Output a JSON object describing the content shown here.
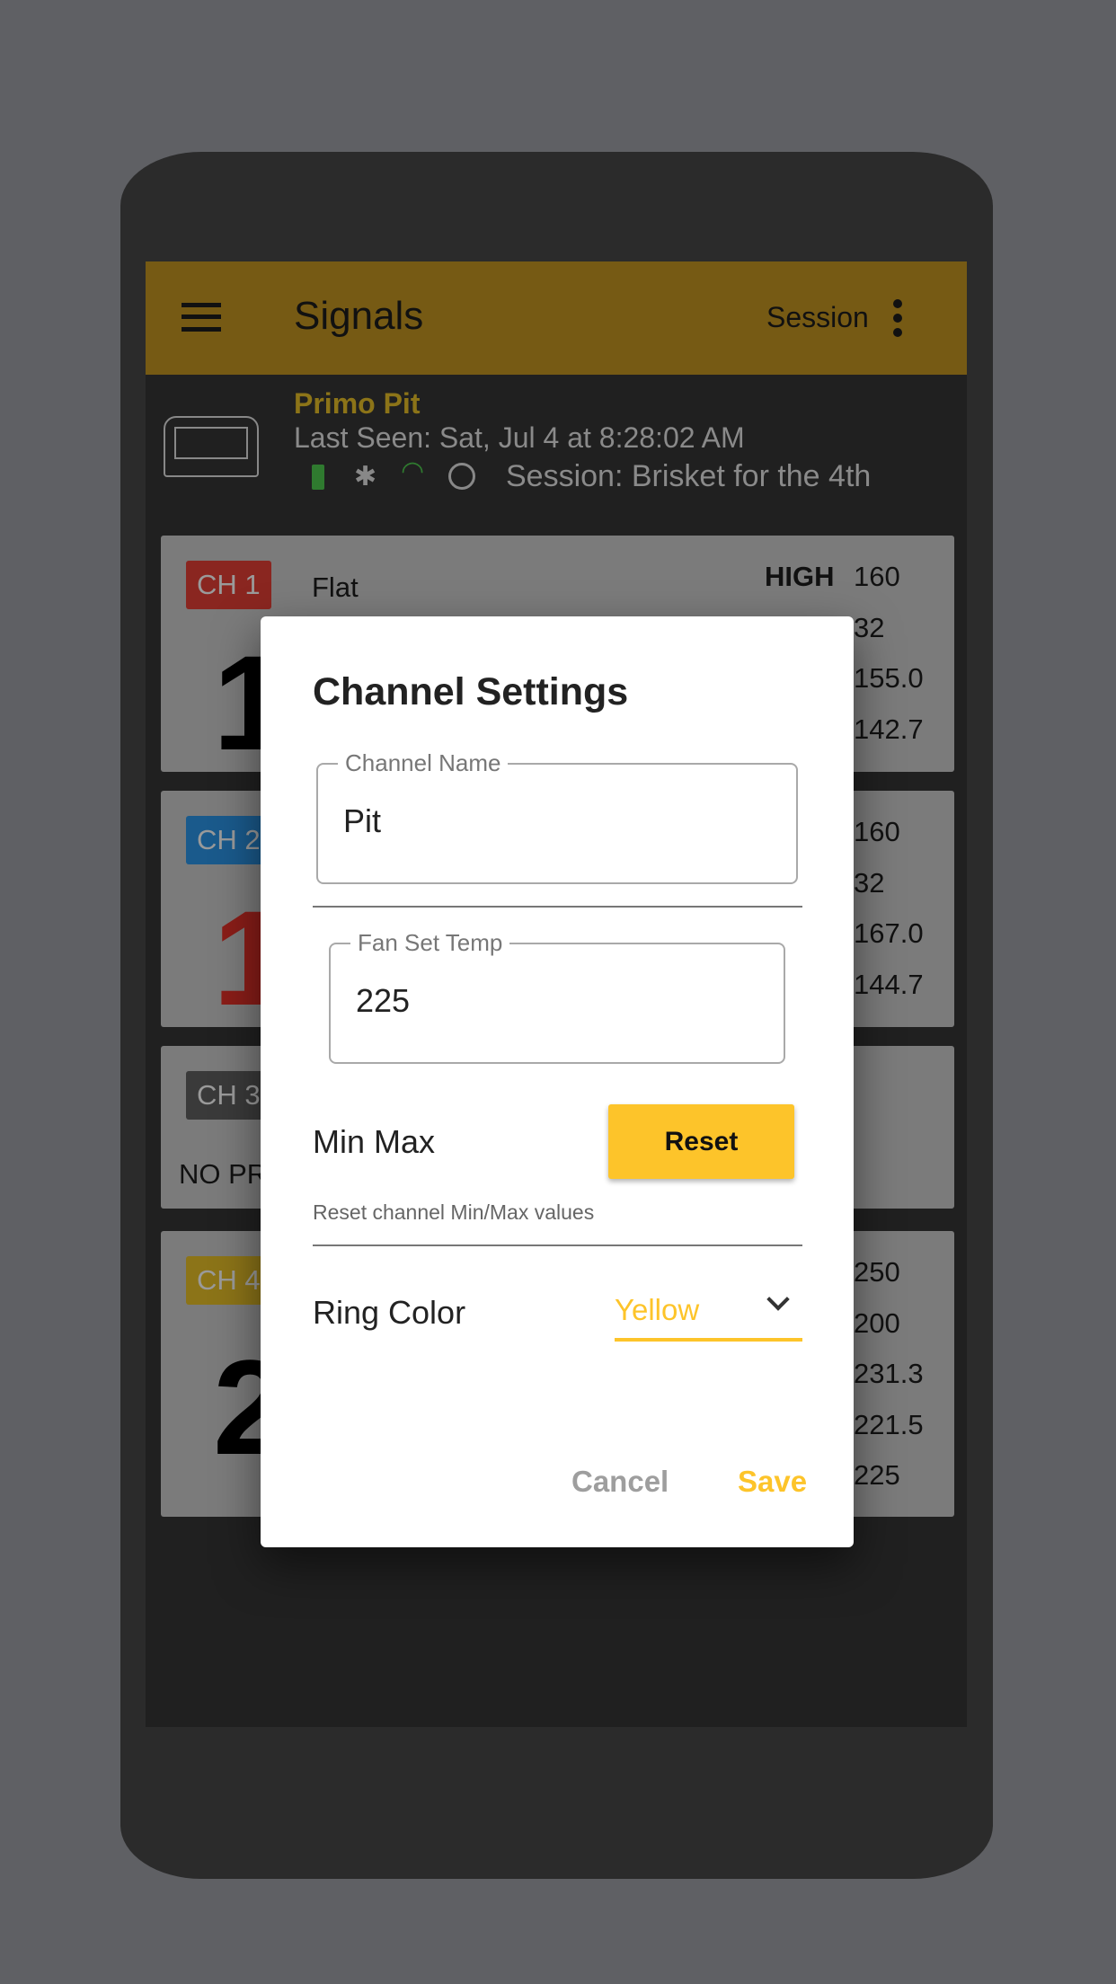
{
  "app_bar": {
    "title": "Signals",
    "session_label": "Session",
    "menu_icon": "hamburger-icon",
    "overflow_icon": "more-vert-icon",
    "color": "#765a14"
  },
  "device": {
    "name": "Primo Pit",
    "last_seen": "Last Seen: Sat, Jul 4 at 8:28:02 AM",
    "session": "Session: Brisket for the 4th",
    "status_icons": [
      "battery-icon",
      "bluetooth-icon",
      "wifi-icon",
      "fan-icon"
    ]
  },
  "channels": [
    {
      "label": "CH 1",
      "color": "#8a2620",
      "name": "Flat",
      "temp": "1",
      "high_label": "HIGH",
      "values": [
        "160",
        "32",
        "155.0",
        "142.7"
      ]
    },
    {
      "label": "CH 2",
      "color": "#1a5a8c",
      "temp": "1",
      "values": [
        "160",
        "32",
        "167.0",
        "144.7"
      ]
    },
    {
      "label": "CH 3",
      "color": "#3a3a3a",
      "status": "NO PR"
    },
    {
      "label": "CH 4",
      "color": "#8c7418",
      "temp": "2",
      "values": [
        "250",
        "200",
        "231.3",
        "221.5",
        "225"
      ]
    }
  ],
  "dialog": {
    "title": "Channel Settings",
    "channel_name": {
      "label": "Channel Name",
      "value": "Pit"
    },
    "fan_set_temp": {
      "label": "Fan Set Temp",
      "value": "225"
    },
    "min_max": {
      "label": "Min Max",
      "button": "Reset",
      "helper": "Reset channel Min/Max values"
    },
    "ring_color": {
      "label": "Ring Color",
      "selected": "Yellow"
    },
    "cancel": "Cancel",
    "save": "Save",
    "accent": "#fdc42a"
  }
}
